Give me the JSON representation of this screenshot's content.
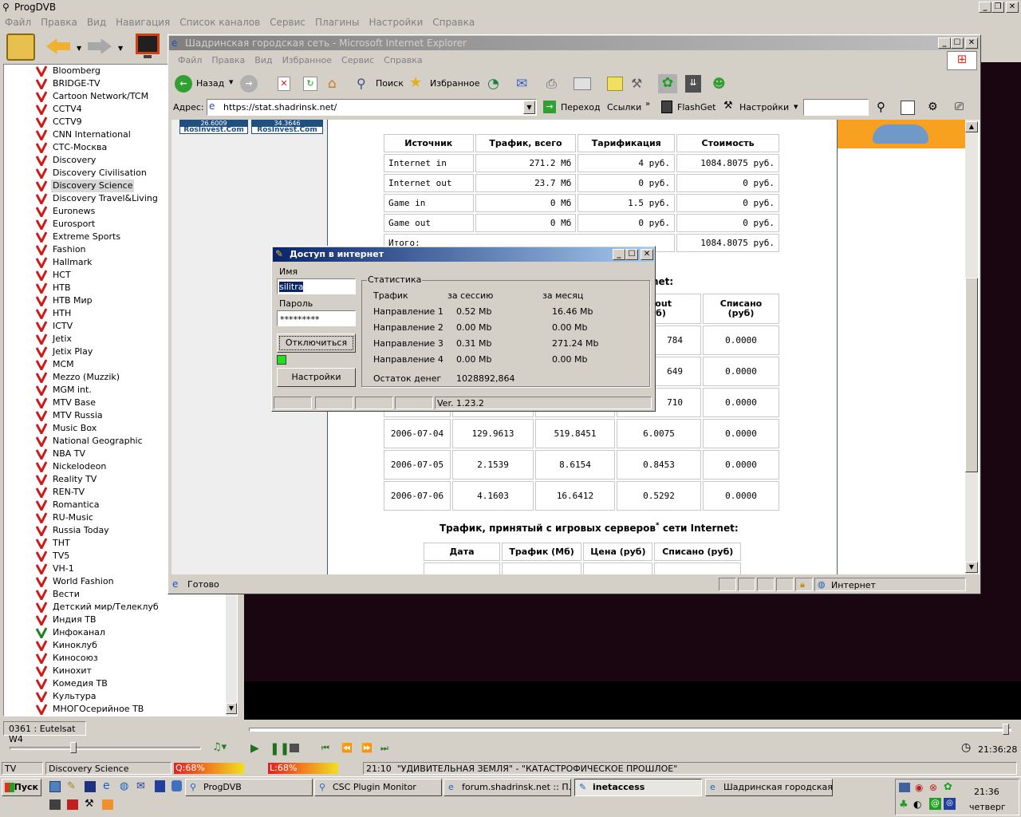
{
  "progdvb": {
    "title": "ProgDVB",
    "menu": [
      "Файл",
      "Правка",
      "Вид",
      "Навигация",
      "Список каналов",
      "Сервис",
      "Плагины",
      "Настройки",
      "Справка"
    ],
    "channels": [
      "Bloomberg",
      "BRIDGE-TV",
      "Cartoon Network/TCM",
      "CCTV4",
      "CCTV9",
      "CNN International",
      "СТС-Москва",
      "Discovery",
      "Discovery Civilisation",
      "Discovery Science",
      "Discovery Travel&Living",
      "Euronews",
      "Eurosport",
      "Extreme Sports",
      "Fashion",
      "Hallmark",
      "НСТ",
      "НТВ",
      "НТВ Мир",
      "НТН",
      "ICTV",
      "Jetix",
      "Jetix Play",
      "MCM",
      "Mezzo (Muzzik)",
      "MGM int.",
      "MTV Base",
      "MTV Russia",
      "Music Box",
      "National Geographic",
      "NBA TV",
      "Nickelodeon",
      "Reality TV",
      "REN-TV",
      "Romantica",
      "RU-Music",
      "Russia Today",
      "ТНТ",
      "TV5",
      "VH-1",
      "World Fashion",
      "Вести",
      "Детский мир/Телеклуб",
      "Индия ТВ",
      "Инфоканал",
      "Киноклуб",
      "Киносоюз",
      "Кинохит",
      "Комедия ТВ",
      "Культура",
      "МНОГОсерийное ТВ"
    ],
    "selected_channel": "Discovery Science",
    "satellite": "0361 : Eutelsat W4",
    "time": "21:36:28",
    "status": {
      "mode": "TV",
      "channel": "Discovery Science",
      "q": "Q:68%",
      "l": "L:68%",
      "program": "21:10  \"УДИВИТЕЛЬНАЯ ЗЕМЛЯ\" - \"КАТАСТРОФИЧЕСКОЕ ПРОШЛОЕ\""
    }
  },
  "ie": {
    "title": "Шадринская городская сеть - Microsoft Internet Explorer",
    "menu": [
      "Файл",
      "Правка",
      "Вид",
      "Избранное",
      "Сервис",
      "Справка"
    ],
    "back": "Назад",
    "search": "Поиск",
    "favorites": "Избранное",
    "address_label": "Адрес:",
    "address": "https://stat.shadrinsk.net/",
    "go": "Переход",
    "links": "Ссылки",
    "flashget": "FlashGet",
    "settings": "Настройки",
    "status": "Готово",
    "zone": "Интернет",
    "ads": [
      {
        "num": "26.6009",
        "name": "RosInvest.Com"
      },
      {
        "num": "34.3646",
        "name": "RosInvest.Com"
      }
    ],
    "table1": {
      "headers": [
        "Источник",
        "Трафик, всего",
        "Тарификация",
        "Стоимость"
      ],
      "rows": [
        [
          "Internet in",
          "271.2 Мб",
          "4 руб.",
          "1084.8075 руб."
        ],
        [
          "Internet out",
          "23.7 Мб",
          "0 руб.",
          "0 руб."
        ],
        [
          "Game in",
          "0 Мб",
          "1.5 руб.",
          "0 руб."
        ],
        [
          "Game out",
          "0 Мб",
          "0 руб.",
          "0 руб."
        ]
      ],
      "total_label": "Итого:",
      "total_value": "1084.8075 руб."
    },
    "table2": {
      "heading_fragment": "net:",
      "headers": [
        "к out\n(б)",
        "Списано\n(руб)"
      ],
      "partial_rows": [
        [
          "784",
          "0.0000"
        ],
        [
          "649",
          "0.0000"
        ],
        [
          "710",
          "0.0000"
        ]
      ],
      "rows": [
        [
          "2006-07-04",
          "129.9613",
          "519.8451",
          "6.0075",
          "0.0000"
        ],
        [
          "2006-07-05",
          "2.1539",
          "8.6154",
          "0.8453",
          "0.0000"
        ],
        [
          "2006-07-06",
          "4.1603",
          "16.6412",
          "0.5292",
          "0.0000"
        ]
      ]
    },
    "table3": {
      "heading": "Трафик, принятый с игровых серверов",
      "heading_tail": "сети Internet:",
      "star": "*",
      "headers": [
        "Дата",
        "Трафик (Мб)",
        "Цена (руб)",
        "Списано (руб)"
      ]
    }
  },
  "dialog": {
    "title": "Доступ в интернет",
    "name_label": "Имя",
    "name_value": "silitra",
    "password_label": "Пароль",
    "password_value": "*********",
    "disconnect": "Отключиться",
    "settings": "Настройки",
    "stats_title": "Статистика",
    "col_traffic": "Трафик",
    "col_session": "за сессию",
    "col_month": "за месяц",
    "rows": [
      [
        "Направление 1",
        "0.52 Mb",
        "16.46 Mb"
      ],
      [
        "Направление 2",
        "0.00 Mb",
        "0.00 Mb"
      ],
      [
        "Направление 3",
        "0.31 Mb",
        "271.24 Mb"
      ],
      [
        "Направление 4",
        "0.00 Mb",
        "0.00 Mb"
      ]
    ],
    "balance_label": "Остаток денег",
    "balance_value": "1028892,864",
    "version": "Ver. 1.23.2"
  },
  "taskbar": {
    "start": "Пуск",
    "tasks": [
      "ProgDVB",
      "CSC Plugin Monitor",
      "forum.shadrinsk.net :: П...",
      "inetaccess",
      "Шадринская городская..."
    ],
    "clock": "21:36",
    "day": "четверг"
  }
}
